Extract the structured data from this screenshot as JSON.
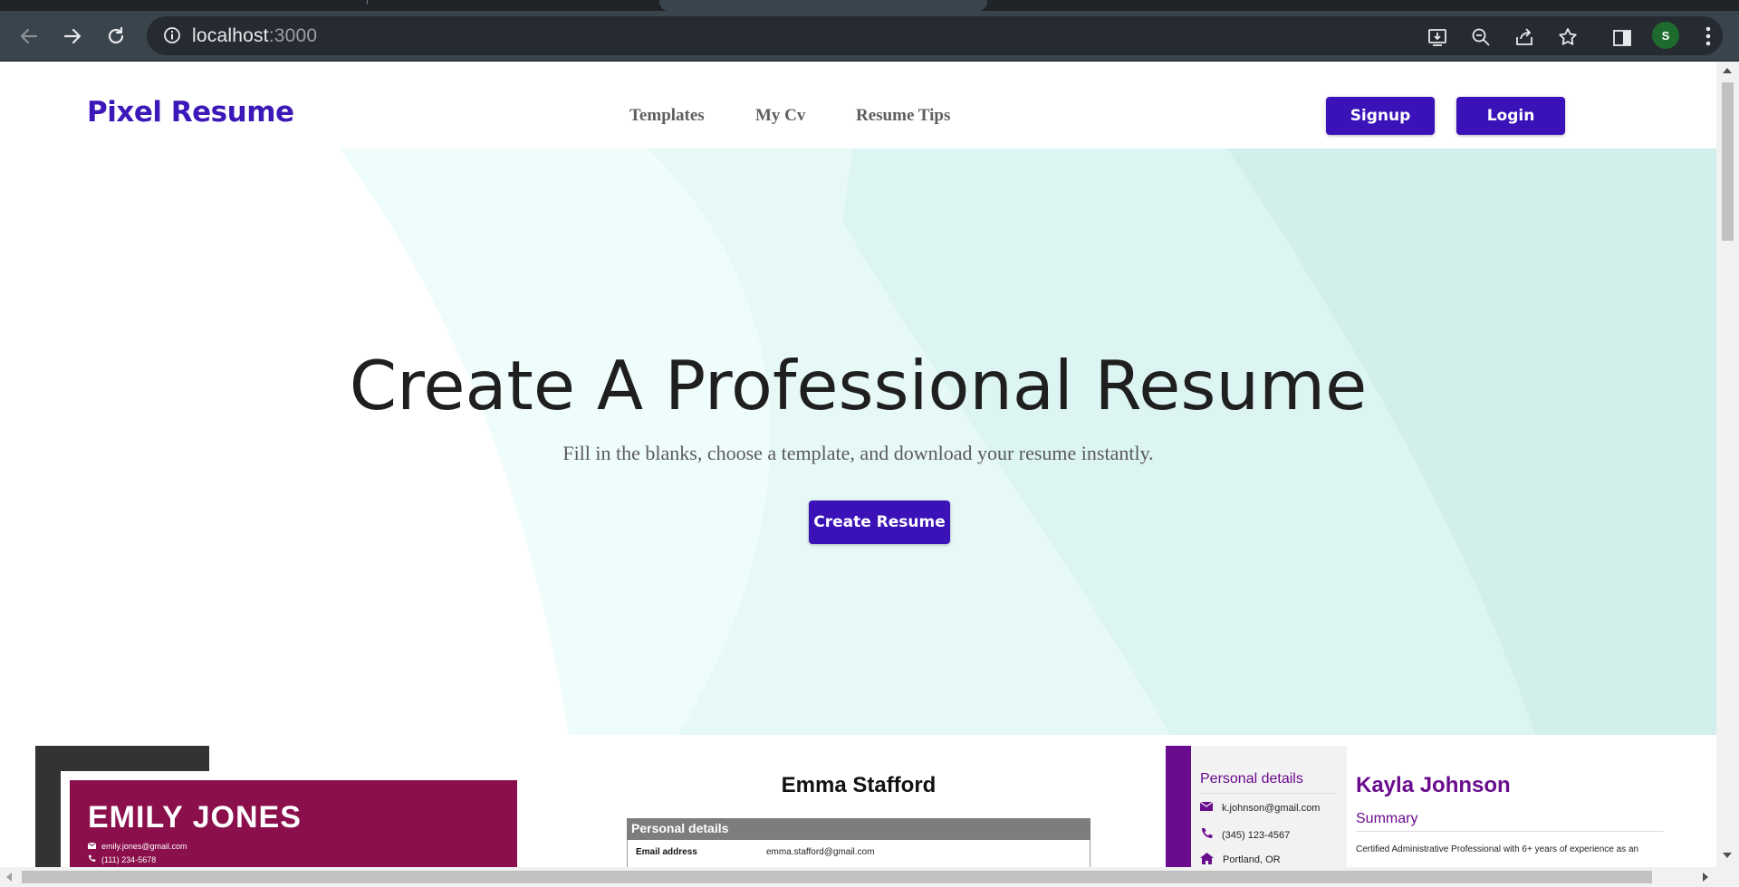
{
  "browser": {
    "url_host": "localhost",
    "url_port": ":3000",
    "profile_initial": "S",
    "icons": [
      "back-arrow-icon",
      "forward-arrow-icon",
      "reload-icon",
      "info-icon",
      "install-app-icon",
      "zoom-icon",
      "share-icon",
      "bookmark-star-icon",
      "side-panel-icon",
      "kebab-menu-icon"
    ]
  },
  "header": {
    "logo": "Pixel Resume",
    "nav": [
      "Templates",
      "My Cv",
      "Resume Tips"
    ],
    "signup_label": "Signup",
    "login_label": "Login"
  },
  "hero": {
    "title": "Create A Professional Resume",
    "subtitle": "Fill in the blanks, choose a template, and download your resume instantly.",
    "cta_label": "Create Resume"
  },
  "templates": [
    {
      "name": "EMILY JONES",
      "email": "emily.jones@gmail.com",
      "phone": "(111) 234-5678"
    },
    {
      "name": "Emma Stafford",
      "section": "Personal details",
      "email_label": "Email address",
      "email": "emma.stafford@gmail.com"
    },
    {
      "name": "Kayla Johnson",
      "side_title": "Personal details",
      "email": "k.johnson@gmail.com",
      "phone": "(345) 123-4567",
      "location": "Portland, OR",
      "summary_title": "Summary",
      "summary_text": "Certified Administrative Professional with 6+ years of experience as an"
    }
  ],
  "colors": {
    "brand": "#3d18b8",
    "button": "#3a12b8",
    "template1_accent": "#8a0f4b",
    "template3_accent": "#6a0c8e",
    "hero_mint": "#d6f3f0"
  }
}
